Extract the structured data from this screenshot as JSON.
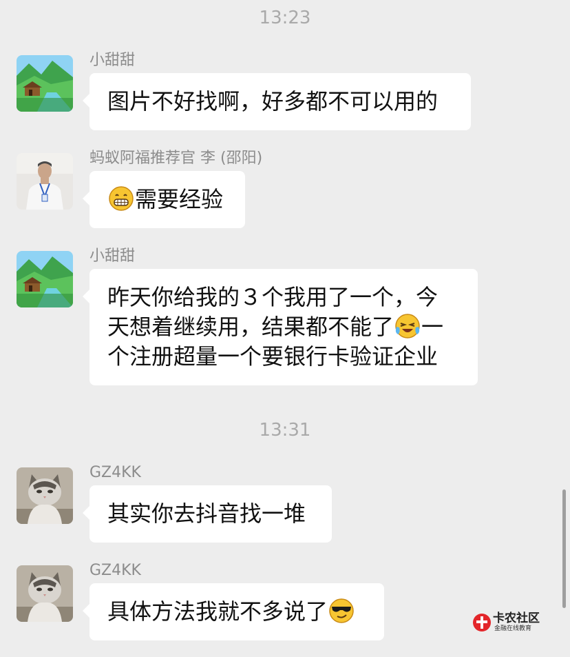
{
  "timestamps": [
    "13:23",
    "13:31"
  ],
  "messages": [
    {
      "sender": "小甜甜",
      "avatar": "landscape-avatar",
      "segments": [
        "图片不好找啊，好多都不可以用的"
      ]
    },
    {
      "sender": "蚂蚁阿福推荐官 李 (邵阳)",
      "avatar": "man-avatar",
      "segments": [
        "",
        "需要经验"
      ],
      "emoji": [
        "grinning-emoji"
      ]
    },
    {
      "sender": "小甜甜",
      "avatar": "landscape-avatar",
      "lines": [
        "昨天你给我的３个我用了一个，今",
        "天想着继续用，结果都不能了",
        "一",
        "个注册超量一个要银行卡验证企业"
      ],
      "emoji": [
        "crying-laughing-emoji"
      ]
    },
    {
      "sender": "GZ4KK",
      "avatar": "cat-avatar",
      "segments": [
        "其实你去抖音找一堆"
      ]
    },
    {
      "sender": "GZ4KK",
      "avatar": "cat-avatar",
      "segments": [
        "具体方法我就不多说了"
      ],
      "emoji": [
        "sunglasses-emoji"
      ]
    }
  ],
  "watermark": {
    "title": "卡农社区",
    "subtitle": "金融在线教育"
  },
  "colors": {
    "background": "#ededed",
    "bubble": "#ffffff",
    "meta_text": "#8c8c8c",
    "watermark_accent": "#e3262a"
  }
}
